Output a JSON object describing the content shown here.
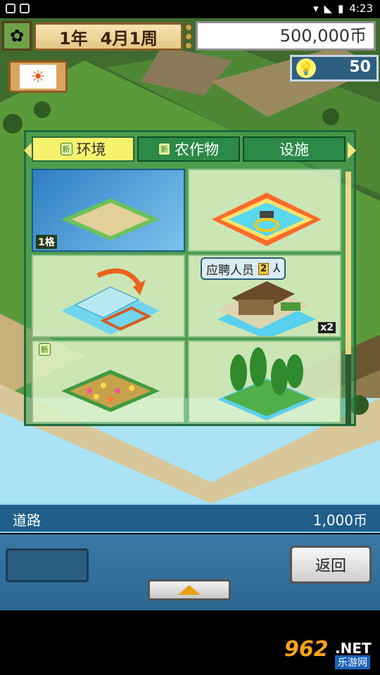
{
  "status_bar": {
    "time": "4:23"
  },
  "hud": {
    "year": "1年",
    "month_week": "4月1周",
    "money": "500,000币",
    "ideas": "50",
    "weather_icon": "sun-icon",
    "flower_icon": "cherry-blossom-icon"
  },
  "panel": {
    "tabs": [
      {
        "label": "环境",
        "new": "新",
        "active": true
      },
      {
        "label": "农作物",
        "new": "新",
        "active": false
      },
      {
        "label": "设施",
        "new": "",
        "active": false
      }
    ],
    "items": [
      {
        "id": "road",
        "label": "1格",
        "selected": true
      },
      {
        "id": "fountain",
        "label": "",
        "selected": false
      },
      {
        "id": "pool-move",
        "label": "",
        "selected": false
      },
      {
        "id": "house",
        "badge": "应聘人员",
        "badge_count": "2",
        "count": "x2",
        "selected": false
      },
      {
        "id": "flower-field",
        "new": "新",
        "selected": false
      },
      {
        "id": "trees",
        "selected": false
      }
    ]
  },
  "info": {
    "name": "道路",
    "price": "1,000币"
  },
  "buttons": {
    "back": "返回"
  },
  "watermark": {
    "number": "962",
    "net": ".NET",
    "sub": "乐游网"
  }
}
